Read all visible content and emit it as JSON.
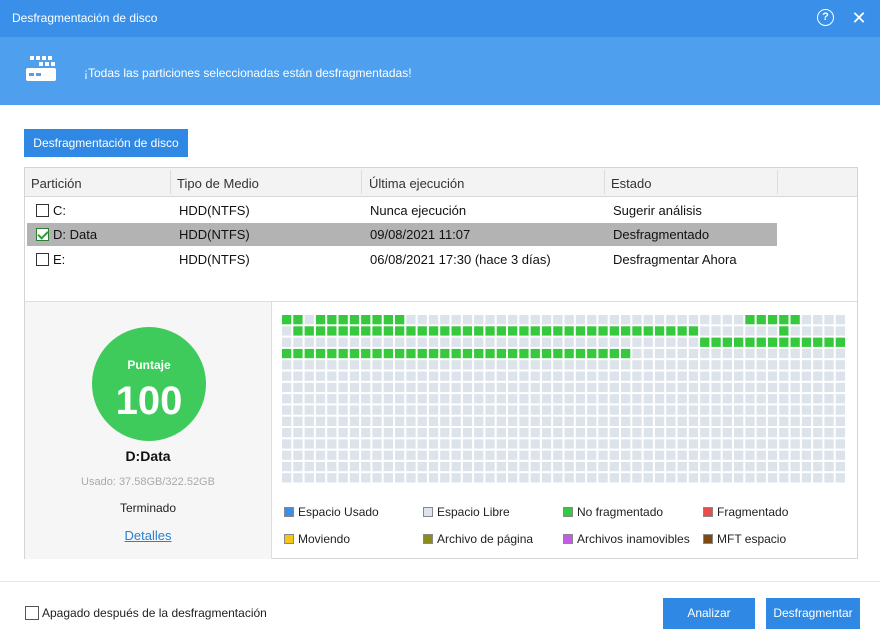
{
  "window": {
    "title": "Desfragmentación de disco",
    "help_glyph": "?",
    "close_glyph": "✕"
  },
  "banner": {
    "message": "¡Todas las particiones seleccionadas están desfragmentadas!"
  },
  "tab": {
    "label": "Desfragmentación de disco"
  },
  "table": {
    "headers": [
      "Partición",
      "Tipo de Medio",
      "Última ejecución",
      "Estado"
    ],
    "rows": [
      {
        "checked": false,
        "selected": false,
        "partition": "C:",
        "media": "HDD(NTFS)",
        "last_run": "Nunca ejecución",
        "status": "Sugerir análisis"
      },
      {
        "checked": true,
        "selected": true,
        "partition": "D:  Data",
        "media": "HDD(NTFS)",
        "last_run": "09/08/2021 11:07",
        "status": "Desfragmentado"
      },
      {
        "checked": false,
        "selected": false,
        "partition": "E:",
        "media": "HDD(NTFS)",
        "last_run": "06/08/2021 17:30 (hace 3 días)",
        "status": "Desfragmentar Ahora"
      }
    ]
  },
  "summary": {
    "score_label": "Puntaje",
    "score": "100",
    "drive": "D:Data",
    "used": "Usado: 37.58GB/322.52GB",
    "status": "Terminado",
    "details_link": "Detalles"
  },
  "legend": [
    {
      "label": "Espacio Usado",
      "color": "#3e8ee6"
    },
    {
      "label": "Espacio Libre",
      "color": "#dde3ea"
    },
    {
      "label": "No fragmentado",
      "color": "#36c83d"
    },
    {
      "label": "Fragmentado",
      "color": "#e84c4c"
    },
    {
      "label": "Moviendo",
      "color": "#f5c518"
    },
    {
      "label": "Archivo de página",
      "color": "#8b8b1e"
    },
    {
      "label": "Archivos inamovibles",
      "color": "#c25ce6"
    },
    {
      "label": "MFT espacio",
      "color": "#7a4a12"
    }
  ],
  "footer": {
    "shutdown_label": "Apagado después de la desfragmentación",
    "analyze_label": "Analizar",
    "defrag_label": "Desfragmentar"
  },
  "colors": {
    "titlebar": "#3a90e8",
    "banner": "#4ea0ef",
    "accent": "#2f88e3",
    "score_circle": "#3ecb5b",
    "block_used": "#36c83d",
    "block_free": "#dde3ea"
  }
}
